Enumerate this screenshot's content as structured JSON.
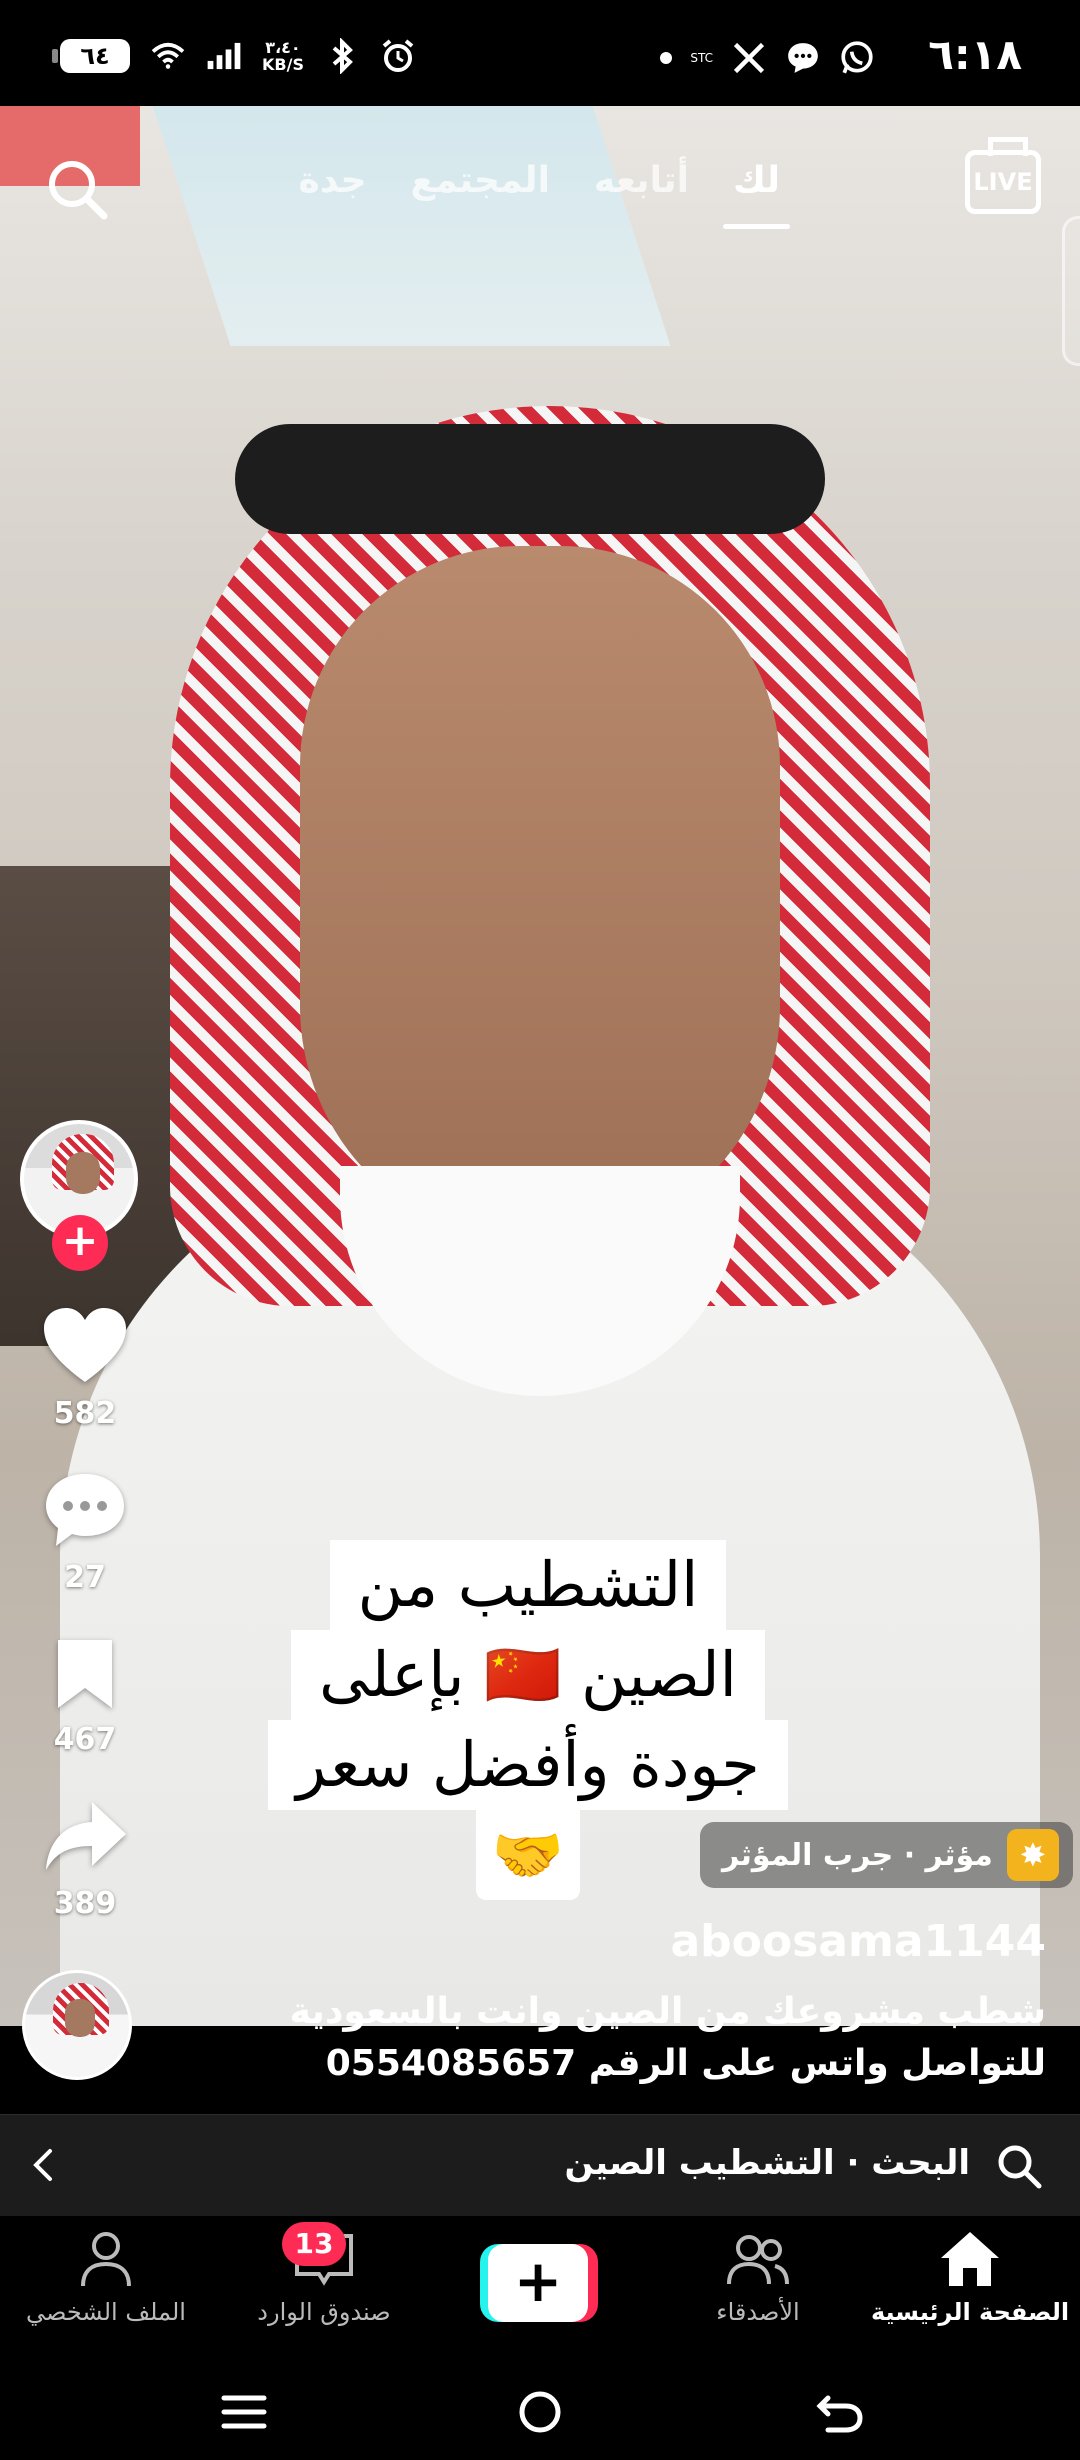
{
  "status_bar": {
    "time": "٦:١٨",
    "battery": "٦٤",
    "net_speed_value": "٣،٤٠",
    "net_speed_unit": "KB/S",
    "carrier_label": "STC"
  },
  "top_nav": {
    "live_label": "LIVE",
    "tabs": [
      {
        "label": "جدة"
      },
      {
        "label": "المجتمع"
      },
      {
        "label": "أتابعه"
      },
      {
        "label": "لك"
      }
    ]
  },
  "actions": {
    "likes": "582",
    "comments": "27",
    "saves": "467",
    "shares": "389"
  },
  "video_caption": {
    "line1": "التشطيب من",
    "line2": "الصين 🇨🇳 بإعلى",
    "line3": "جودة وأفضل سعر",
    "emoji": "🤝"
  },
  "effect": {
    "label": "مؤثر · جرب المؤثر"
  },
  "post": {
    "username": "aboosama1144",
    "description": "شطب مشروعك من الصين وانت بالسعودية للتواصل واتس على الرقم 0554085657"
  },
  "search": {
    "text": "البحث · التشطيب الصين"
  },
  "bottom_nav": {
    "home": "الصفحة الرئيسية",
    "friends": "الأصدقاء",
    "inbox": "صندوق الوارد",
    "inbox_badge": "13",
    "profile": "الملف الشخصي"
  },
  "colors": {
    "accent": "#fe2c55",
    "cyan": "#25f4ee",
    "effect_yellow": "#f3b31c"
  }
}
